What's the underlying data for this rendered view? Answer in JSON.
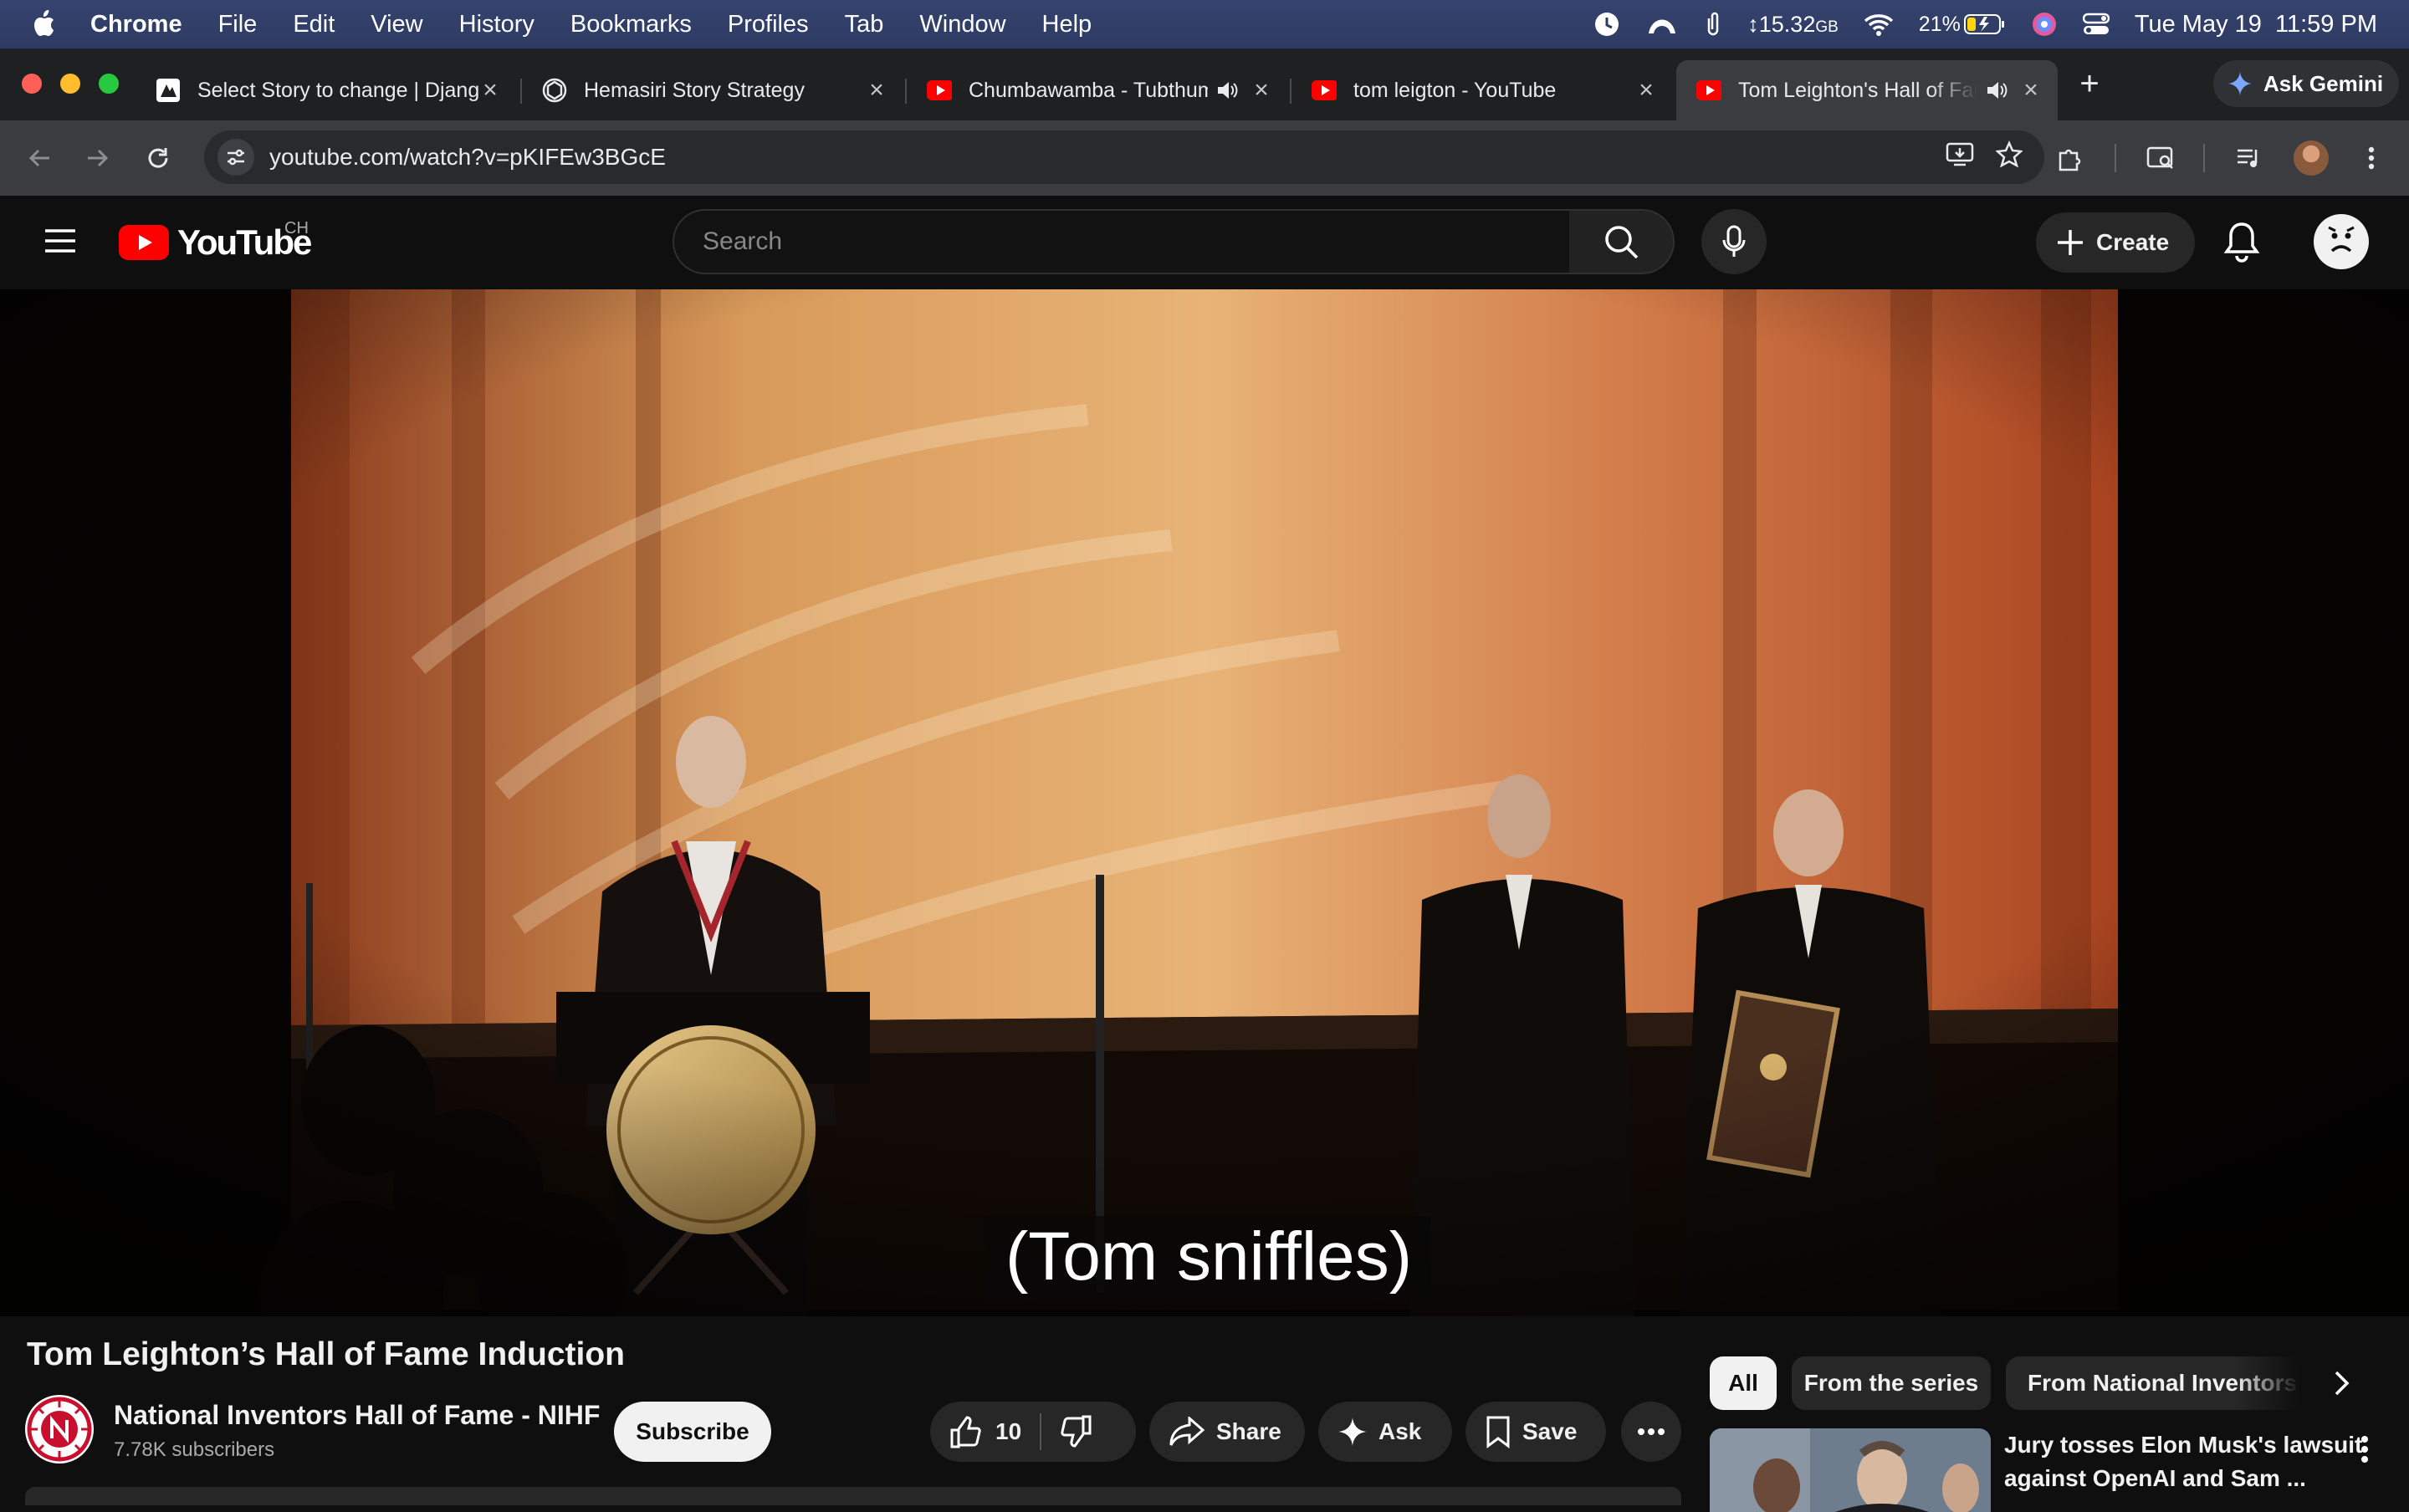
{
  "menubar": {
    "app_name": "Chrome",
    "menus": [
      "File",
      "Edit",
      "View",
      "History",
      "Bookmarks",
      "Profiles",
      "Tab",
      "Window",
      "Help"
    ],
    "memory": "15.32",
    "memory_unit": "GB",
    "battery": "21%",
    "datetime": "Tue May 19  11:59 PM"
  },
  "browser": {
    "tabs": [
      {
        "title": "Select Story to change | Django",
        "icon": "django-admin-icon"
      },
      {
        "title": "Hemasiri Story Strategy",
        "icon": "openai-icon"
      },
      {
        "title": "Chumbawamba - Tubthumping",
        "icon": "youtube-favicon",
        "audio": true
      },
      {
        "title": "tom leigton - YouTube",
        "icon": "youtube-favicon"
      },
      {
        "title": "Tom Leighton's Hall of Fame",
        "icon": "youtube-favicon",
        "audio": true,
        "active": true
      }
    ],
    "new_tab": "+",
    "gemini_label": "Ask Gemini",
    "url": "youtube.com/watch?v=pKIFEw3BGcE"
  },
  "youtube": {
    "logo_text": "YouTube",
    "country_code": "CH",
    "search_placeholder": "Search",
    "create_label": "Create",
    "caption": "(Tom sniffles)",
    "video_title": "Tom Leighton’s Hall of Fame Induction",
    "channel_name": "National Inventors Hall of Fame - NIHF",
    "subscribers": "7.78K subscribers",
    "subscribe_label": "Subscribe",
    "like_count": "10",
    "share_label": "Share",
    "ask_label": "Ask",
    "save_label": "Save",
    "chips": [
      "All",
      "From the series",
      "From National Inventors Hall of Fame"
    ],
    "recommendation": {
      "title_line1": "Jury tosses Elon Musk's lawsuit",
      "title_line2": "against OpenAI and Sam ..."
    }
  },
  "colors": {
    "youtube_red": "#ff0000",
    "menubar_blue": "#2d3a63",
    "background": "#0f0f0f",
    "chip_bg": "#272727"
  }
}
